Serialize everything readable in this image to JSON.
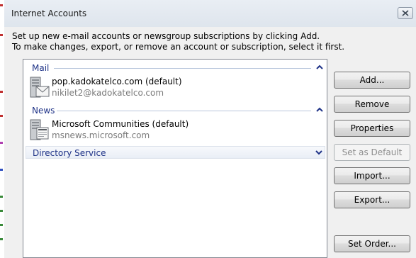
{
  "window": {
    "title": "Internet Accounts"
  },
  "instructions": {
    "line1": "Set up new e-mail accounts or newsgroup subscriptions by clicking Add.",
    "line2": "To make changes, export, or remove an account or subscription, select it first."
  },
  "groups": {
    "mail": {
      "label": "Mail",
      "account": {
        "name": "pop.kadokatelco.com (default)",
        "detail": "nikilet2@kadokatelco.com"
      }
    },
    "news": {
      "label": "News",
      "account": {
        "name": "Microsoft Communities (default)",
        "detail": "msnews.microsoft.com"
      }
    },
    "directory": {
      "label": "Directory Service"
    }
  },
  "buttons": {
    "add": "Add...",
    "remove": "Remove",
    "properties": "Properties",
    "set_default": "Set as Default",
    "import": "Import...",
    "export": "Export...",
    "set_order": "Set Order..."
  },
  "colors": {
    "group_header_text": "#1e3287",
    "secondary_text": "#7a7a7a",
    "dialog_bg": "#f0f0f0"
  }
}
